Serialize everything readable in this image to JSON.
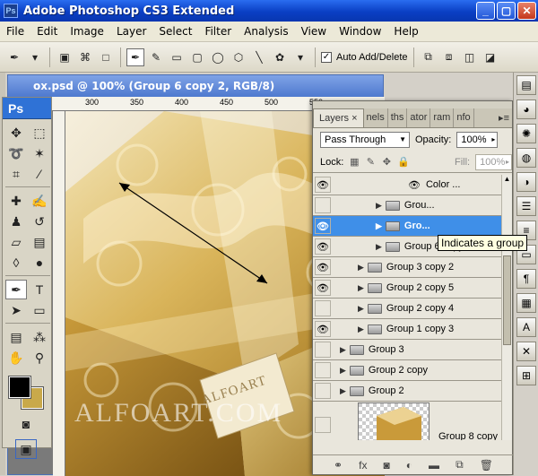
{
  "app": {
    "title": "Adobe Photoshop CS3 Extended",
    "logo": "Ps"
  },
  "menu": [
    "File",
    "Edit",
    "Image",
    "Layer",
    "Select",
    "Filter",
    "Analysis",
    "View",
    "Window",
    "Help"
  ],
  "options": {
    "auto_add_delete_checked": true,
    "auto_add_delete_label": "Auto Add/Delete"
  },
  "document": {
    "title": "ox.psd @ 100% (Group 6 copy 2, RGB/8)",
    "ruler_ticks": [
      "300",
      "350",
      "400",
      "450",
      "500",
      "550"
    ]
  },
  "toolbox": {
    "label": "Ps"
  },
  "colors": {
    "foreground": "#000000",
    "background": "#c9a94a"
  },
  "watermark": "ALFOART.COM",
  "tag_text": "ALFOART",
  "panel": {
    "tabs": [
      {
        "label": "Layers"
      },
      {
        "label": "nels"
      },
      {
        "label": "ths"
      },
      {
        "label": "ator"
      },
      {
        "label": "ram"
      },
      {
        "label": "nfo"
      }
    ],
    "close_glyph": "×",
    "blend_mode": "Pass Through",
    "opacity_label": "Opacity:",
    "opacity": "100%",
    "lock_label": "Lock:",
    "fill_label": "Fill:",
    "fill": "100%",
    "layers": [
      {
        "name": "Color ...",
        "indent": 2,
        "eye": true,
        "folder": false,
        "selected": false
      },
      {
        "name": "Grou...",
        "indent": 2,
        "eye": false,
        "folder": true,
        "selected": false
      },
      {
        "name": "Gro...",
        "indent": 2,
        "eye": true,
        "folder": true,
        "selected": true
      },
      {
        "name": "Group 6 copy",
        "indent": 2,
        "eye": true,
        "folder": true,
        "selected": false
      },
      {
        "name": "Group 3 copy 2",
        "indent": 1,
        "eye": true,
        "folder": true,
        "selected": false
      },
      {
        "name": "Group 2 copy 5",
        "indent": 1,
        "eye": true,
        "folder": true,
        "selected": false
      },
      {
        "name": "Group 2 copy 4",
        "indent": 1,
        "eye": false,
        "folder": true,
        "selected": false
      },
      {
        "name": "Group 1 copy 3",
        "indent": 1,
        "eye": true,
        "folder": true,
        "selected": false
      },
      {
        "name": "Group 3",
        "indent": 0,
        "eye": false,
        "folder": true,
        "selected": false
      },
      {
        "name": "Group 2 copy",
        "indent": 0,
        "eye": false,
        "folder": true,
        "selected": false
      },
      {
        "name": "Group 2",
        "indent": 0,
        "eye": false,
        "folder": true,
        "selected": false
      }
    ],
    "thumb_layer": "Group 8 copy",
    "tooltip": "Indicates a group"
  }
}
